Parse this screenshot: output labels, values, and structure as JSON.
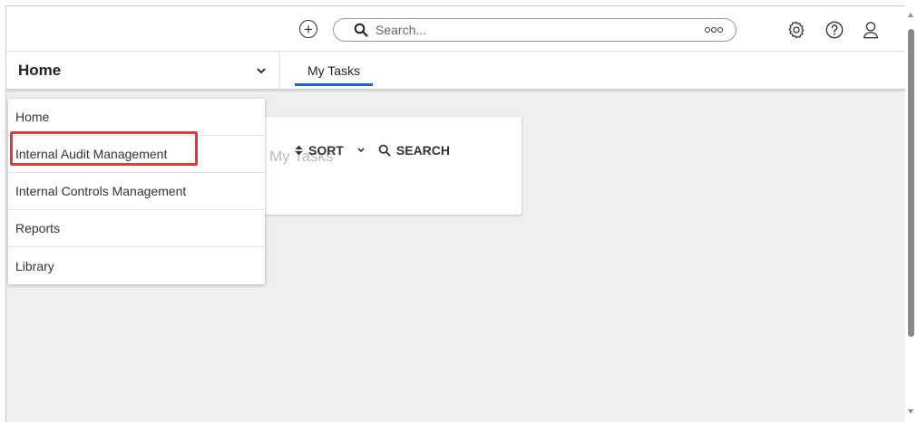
{
  "topbar": {
    "add_icon": "plus-circle-icon",
    "search": {
      "placeholder": "Search...",
      "value": "",
      "options_icon": "more-dots-icon"
    },
    "settings_icon": "gear-icon",
    "help_icon": "help-circle-icon",
    "profile_icon": "user-icon"
  },
  "nav": {
    "app_selector": {
      "label": "Home",
      "chevron": "chevron-down-icon"
    },
    "tabs": [
      {
        "label": "My Tasks",
        "active": true
      }
    ],
    "accent_color": "#1f69c9"
  },
  "card": {
    "title": "My Tasks",
    "sort_label": "SORT",
    "search_label": "SEARCH"
  },
  "dropdown": {
    "items": [
      {
        "label": "Home"
      },
      {
        "label": "Internal Audit Management",
        "highlighted": true
      },
      {
        "label": "Internal Controls Management"
      },
      {
        "label": "Reports"
      },
      {
        "label": "Library"
      }
    ],
    "highlight_color": "#e03a3e"
  }
}
